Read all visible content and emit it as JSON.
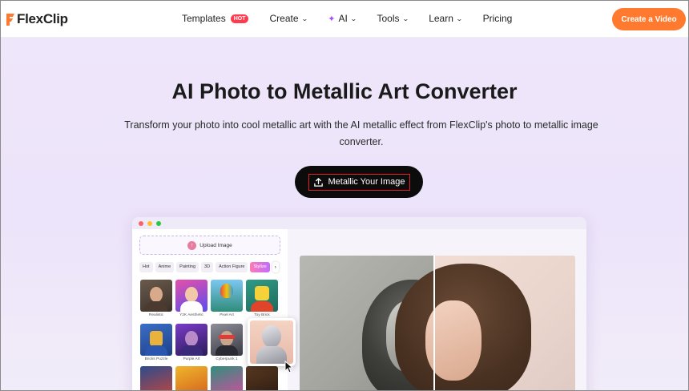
{
  "nav": {
    "logo_text": "FlexClip",
    "menu": [
      {
        "label": "Templates",
        "badge": "HOT",
        "chevron": false
      },
      {
        "label": "Create",
        "chevron": true
      },
      {
        "label": "AI",
        "chevron": true,
        "icon": "sparkle-icon"
      },
      {
        "label": "Tools",
        "chevron": true
      },
      {
        "label": "Learn",
        "chevron": true
      },
      {
        "label": "Pricing",
        "chevron": false
      }
    ],
    "cta_label": "Create a Video"
  },
  "hero": {
    "title": "AI Photo to Metallic Art Converter",
    "subtitle": "Transform your photo into cool metallic art with the AI metallic effect from FlexClip's photo to metallic image converter.",
    "button_label": "Metallic Your Image"
  },
  "mock": {
    "upload_label": "Upload Image",
    "chips": [
      "Hot",
      "Anime",
      "Painting",
      "3D",
      "Action Figure",
      "Stylize"
    ],
    "active_chip": "Stylize",
    "styles": [
      {
        "label": "Realistic"
      },
      {
        "label": "Y2K Aesthetic"
      },
      {
        "label": "Pixel Art"
      },
      {
        "label": "Toy Brick"
      },
      {
        "label": "Bricks Puzzle"
      },
      {
        "label": "Purple Art"
      },
      {
        "label": "Cyberpunk 1"
      }
    ]
  },
  "colors": {
    "accent_orange": "#ff7a2f",
    "hot_badge": "#ff3b4e",
    "cta_bg": "#0c0c0c",
    "highlight_border": "#e0202a"
  }
}
